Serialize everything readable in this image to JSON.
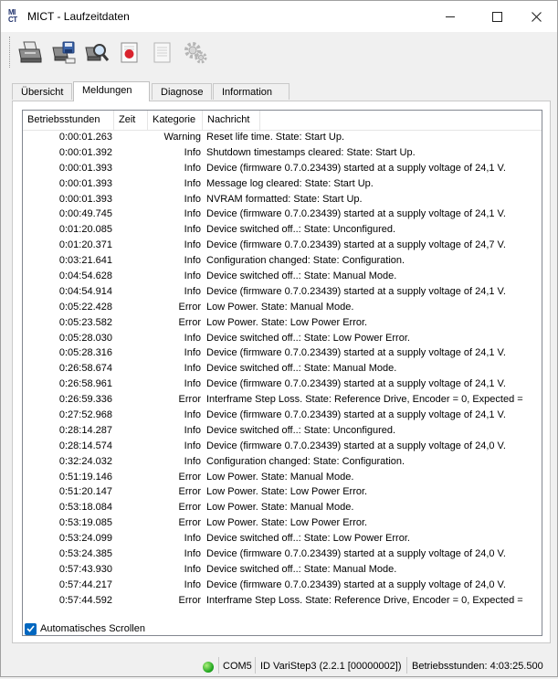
{
  "window": {
    "title": "MICT - Laufzeitdaten",
    "logo_top": "MI",
    "logo_bottom": "CT"
  },
  "toolbar": {
    "buttons": [
      "printer-icon",
      "save-icon",
      "search-icon",
      "record-icon",
      "document-icon",
      "settings-gear-icon"
    ]
  },
  "tabs": [
    {
      "label": "Übersicht",
      "active": false
    },
    {
      "label": "Meldungen",
      "active": true
    },
    {
      "label": "Diagnose",
      "active": false
    },
    {
      "label": "Information",
      "active": false
    }
  ],
  "table": {
    "columns": [
      "Betriebsstunden",
      "Zeit",
      "Kategorie",
      "Nachricht"
    ],
    "rows": [
      [
        "0:00:01.263",
        "",
        "Warning",
        "Reset life time. State: Start Up."
      ],
      [
        "0:00:01.392",
        "",
        "Info",
        "Shutdown timestamps cleared: State: Start Up."
      ],
      [
        "0:00:01.393",
        "",
        "Info",
        "Device (firmware 0.7.0.23439) started at a supply voltage of 24,1 V."
      ],
      [
        "0:00:01.393",
        "",
        "Info",
        "Message log cleared: State: Start Up."
      ],
      [
        "0:00:01.393",
        "",
        "Info",
        "NVRAM formatted: State: Start Up."
      ],
      [
        "0:00:49.745",
        "",
        "Info",
        "Device (firmware 0.7.0.23439) started at a supply voltage of 24,1 V."
      ],
      [
        "0:01:20.085",
        "",
        "Info",
        "Device switched off..: State: Unconfigured."
      ],
      [
        "0:01:20.371",
        "",
        "Info",
        "Device (firmware 0.7.0.23439) started at a supply voltage of 24,7 V."
      ],
      [
        "0:03:21.641",
        "",
        "Info",
        "Configuration changed: State: Configuration."
      ],
      [
        "0:04:54.628",
        "",
        "Info",
        "Device switched off..: State: Manual Mode."
      ],
      [
        "0:04:54.914",
        "",
        "Info",
        "Device (firmware 0.7.0.23439) started at a supply voltage of 24,1 V."
      ],
      [
        "0:05:22.428",
        "",
        "Error",
        "Low Power. State: Manual Mode."
      ],
      [
        "0:05:23.582",
        "",
        "Error",
        "Low Power. State: Low Power Error."
      ],
      [
        "0:05:28.030",
        "",
        "Info",
        "Device switched off..: State: Low Power Error."
      ],
      [
        "0:05:28.316",
        "",
        "Info",
        "Device (firmware 0.7.0.23439) started at a supply voltage of 24,1 V."
      ],
      [
        "0:26:58.674",
        "",
        "Info",
        "Device switched off..: State: Manual Mode."
      ],
      [
        "0:26:58.961",
        "",
        "Info",
        "Device (firmware 0.7.0.23439) started at a supply voltage of 24,1 V."
      ],
      [
        "0:26:59.336",
        "",
        "Error",
        "Interframe Step Loss. State: Reference Drive, Encoder = 0, Expected ="
      ],
      [
        "0:27:52.968",
        "",
        "Info",
        "Device (firmware 0.7.0.23439) started at a supply voltage of 24,1 V."
      ],
      [
        "0:28:14.287",
        "",
        "Info",
        "Device switched off..: State: Unconfigured."
      ],
      [
        "0:28:14.574",
        "",
        "Info",
        "Device (firmware 0.7.0.23439) started at a supply voltage of 24,0 V."
      ],
      [
        "0:32:24.032",
        "",
        "Info",
        "Configuration changed: State: Configuration."
      ],
      [
        "0:51:19.146",
        "",
        "Error",
        "Low Power. State: Manual Mode."
      ],
      [
        "0:51:20.147",
        "",
        "Error",
        "Low Power. State: Low Power Error."
      ],
      [
        "0:53:18.084",
        "",
        "Error",
        "Low Power. State: Manual Mode."
      ],
      [
        "0:53:19.085",
        "",
        "Error",
        "Low Power. State: Low Power Error."
      ],
      [
        "0:53:24.099",
        "",
        "Info",
        "Device switched off..: State: Low Power Error."
      ],
      [
        "0:53:24.385",
        "",
        "Info",
        "Device (firmware 0.7.0.23439) started at a supply voltage of 24,0 V."
      ],
      [
        "0:57:43.930",
        "",
        "Info",
        "Device switched off..: State: Manual Mode."
      ],
      [
        "0:57:44.217",
        "",
        "Info",
        "Device (firmware 0.7.0.23439) started at a supply voltage of 24,0 V."
      ],
      [
        "0:57:44.592",
        "",
        "Error",
        "Interframe Step Loss. State: Reference Drive, Encoder = 0, Expected ="
      ]
    ]
  },
  "autoscroll": {
    "label": "Automatisches Scrollen",
    "checked": true
  },
  "status": {
    "led_color": "#22b522",
    "port": "COM5",
    "device_id": "ID VariStep3 (2.2.1 [00000002])",
    "operating_hours": "Betriebsstunden: 4:03:25.500"
  },
  "colors": {
    "accent": "#0067c0",
    "record": "#d9232d"
  }
}
